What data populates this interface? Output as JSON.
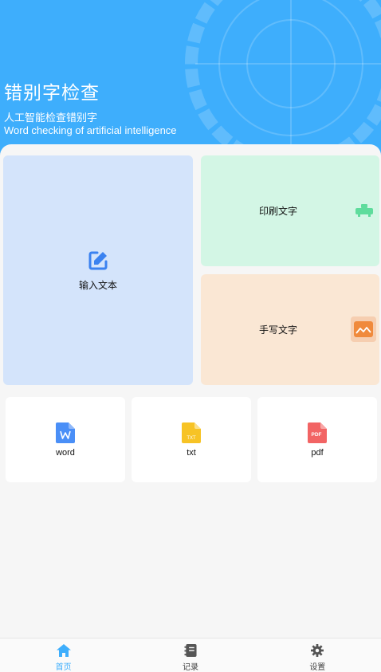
{
  "header": {
    "title": "错别字检查",
    "subtitle_cn": "人工智能检查错别字",
    "subtitle_en": "Word checking of artificial intelligence"
  },
  "cards": {
    "input_text": {
      "label": "输入文本",
      "icon": "edit-icon"
    },
    "print_text": {
      "label": "印刷文字",
      "icon": "printer-icon"
    },
    "hand_text": {
      "label": "手写文字",
      "icon": "image-icon"
    }
  },
  "files": [
    {
      "label": "word",
      "icon": "word-file-icon",
      "badge": "W",
      "color": "#4a8ff7"
    },
    {
      "label": "txt",
      "icon": "txt-file-icon",
      "badge": "TXT",
      "color": "#f7c325"
    },
    {
      "label": "pdf",
      "icon": "pdf-file-icon",
      "badge": "PDF",
      "color": "#f26464"
    }
  ],
  "tabbar": {
    "home": "首页",
    "records": "记录",
    "settings": "设置"
  },
  "colors": {
    "primary": "#3eaefc",
    "card_input": "#d4e4fb",
    "card_print": "#d3f6e5",
    "card_hand": "#fae7d4"
  }
}
